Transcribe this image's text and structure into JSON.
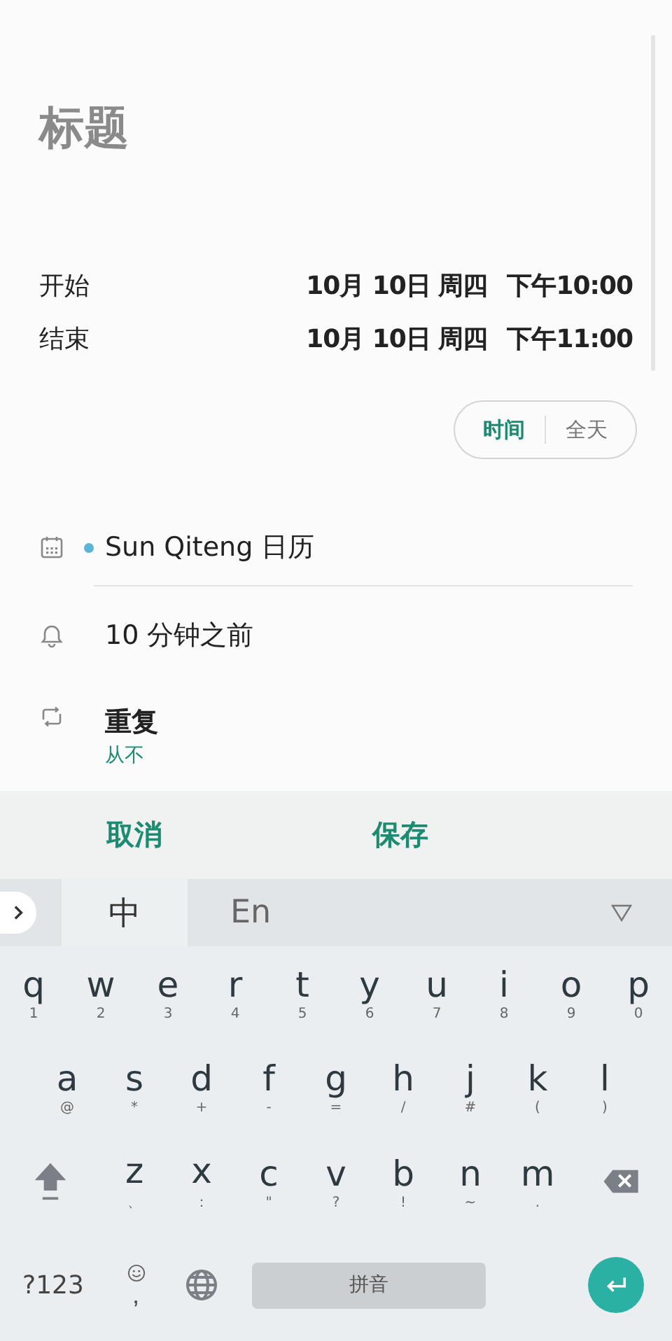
{
  "title": {
    "placeholder": "标题"
  },
  "times": [
    {
      "label": "开始",
      "date": "10月 10日 周四",
      "time": "下午10:00"
    },
    {
      "label": "结束",
      "date": "10月 10日 周四",
      "time": "下午11:00"
    }
  ],
  "mode_toggle": [
    {
      "label": "时间",
      "selected": true
    },
    {
      "label": "全天",
      "selected": false
    }
  ],
  "calendar": "Sun Qiteng 日历",
  "reminder": "10 分钟之前",
  "repeat": {
    "label": "重复",
    "value": "从不"
  },
  "actions": [
    "取消",
    "保存"
  ],
  "ime_tabs": [
    {
      "label": "中",
      "selected": true
    },
    {
      "label": "En",
      "selected": false
    }
  ],
  "key_rows": [
    [
      {
        "key": "q",
        "hint": "1"
      },
      {
        "key": "w",
        "hint": "2"
      },
      {
        "key": "e",
        "hint": "3"
      },
      {
        "key": "r",
        "hint": "4"
      },
      {
        "key": "t",
        "hint": "5"
      },
      {
        "key": "y",
        "hint": "6"
      },
      {
        "key": "u",
        "hint": "7"
      },
      {
        "key": "i",
        "hint": "8"
      },
      {
        "key": "o",
        "hint": "9"
      },
      {
        "key": "p",
        "hint": "0"
      }
    ],
    [
      {
        "key": "a",
        "hint": "@"
      },
      {
        "key": "s",
        "hint": "*"
      },
      {
        "key": "d",
        "hint": "+"
      },
      {
        "key": "f",
        "hint": "-"
      },
      {
        "key": "g",
        "hint": "="
      },
      {
        "key": "h",
        "hint": "/"
      },
      {
        "key": "j",
        "hint": "#"
      },
      {
        "key": "k",
        "hint": "("
      },
      {
        "key": "l",
        "hint": ")"
      }
    ],
    [
      {
        "key": "z",
        "hint": "、"
      },
      {
        "key": "x",
        "hint": "："
      },
      {
        "key": "c",
        "hint": "\""
      },
      {
        "key": "v",
        "hint": "?"
      },
      {
        "key": "b",
        "hint": "!"
      },
      {
        "key": "n",
        "hint": "~"
      },
      {
        "key": "m",
        "hint": "."
      }
    ]
  ],
  "symbols_key": "?123",
  "comma_key": ",",
  "space_key": "拼音"
}
